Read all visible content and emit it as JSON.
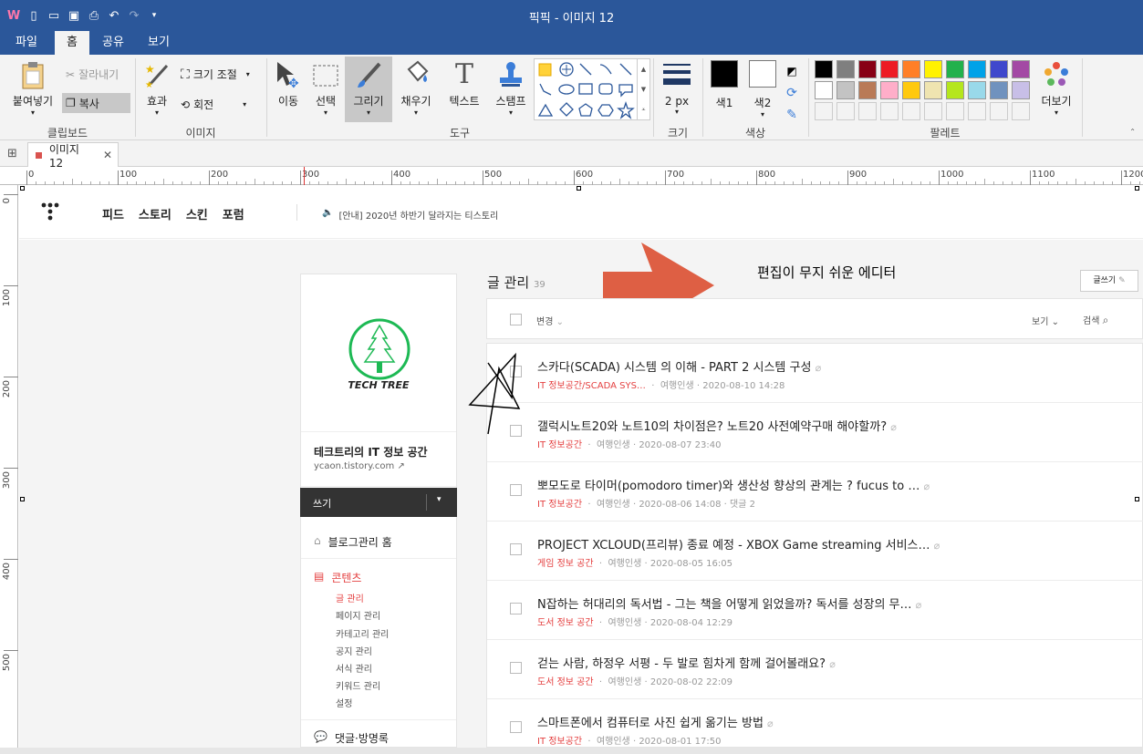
{
  "app": {
    "title": "픽픽 - 이미지 12"
  },
  "menu": {
    "items": [
      "파일",
      "홈",
      "공유",
      "보기"
    ],
    "active": "홈"
  },
  "ribbon": {
    "clipboard": {
      "paste": "붙여넣기",
      "cut": "잘라내기",
      "copy": "복사",
      "label": "클립보드"
    },
    "image": {
      "effect": "효과",
      "resize": "크기 조절",
      "rotate": "회전",
      "label": "이미지"
    },
    "tools": {
      "move": "이동",
      "select": "선택",
      "draw": "그리기",
      "fill": "채우기",
      "text": "텍스트",
      "stamp": "스탬프",
      "label": "도구"
    },
    "size": {
      "value": "2 px",
      "label": "크기"
    },
    "color": {
      "color1": "색1",
      "color2": "색2",
      "label": "색상",
      "color1_value": "#000000",
      "color2_value": "#ffffff"
    },
    "palette": {
      "label": "팔레트",
      "more": "더보기",
      "row1": [
        "#000000",
        "#7f7f7f",
        "#880015",
        "#ed1c24",
        "#ff7f27",
        "#fff200",
        "#22b14c",
        "#00a2e8",
        "#3f48cc",
        "#a349a4"
      ],
      "row2": [
        "#ffffff",
        "#c3c3c3",
        "#b97a57",
        "#ffaec9",
        "#ffc90e",
        "#efe4b0",
        "#b5e61d",
        "#99d9ea",
        "#7092be",
        "#c8bfe7"
      ],
      "row3": [
        "#f3f3f3",
        "#f3f3f3",
        "#f3f3f3",
        "#f3f3f3",
        "#f3f3f3",
        "#f3f3f3",
        "#f3f3f3",
        "#f3f3f3",
        "#f3f3f3",
        "#f3f3f3"
      ]
    }
  },
  "doc": {
    "tab": "이미지 12"
  },
  "ruler": {
    "h": [
      "0",
      "100",
      "200",
      "300",
      "400",
      "500",
      "600",
      "700",
      "800",
      "900",
      "1000",
      "1100",
      "1200"
    ],
    "v": [
      "0",
      "100",
      "200",
      "300",
      "400",
      "500"
    ]
  },
  "blog": {
    "nav": [
      "피드",
      "스토리",
      "스킨",
      "포럼"
    ],
    "notice": "[안내] 2020년 하반기 달라지는 티스토리",
    "page_title": "글 관리",
    "post_count": "39",
    "write_btn": "글쓰기",
    "change": "변경",
    "view": "보기",
    "search": "검색",
    "annotation": "편집이 무지 쉬운 에디터",
    "logo_text": "TECH TREE",
    "blog_name": "테크트리의 IT 정보 공간",
    "blog_url": "ycaon.tistory.com",
    "write": "쓰기",
    "menu_home": "블로그관리 홈",
    "menu_contents": "콘텐츠",
    "sub": [
      "글 관리",
      "페이지 관리",
      "카테고리 관리",
      "공지 관리",
      "서식 관리",
      "키워드 관리",
      "설정"
    ],
    "menu_comments": "댓글·방명록",
    "posts": [
      {
        "title": "스카다(SCADA) 시스템 의 이해 - PART 2 시스템 구성",
        "cat": "IT 정보공간/SCADA SYS…",
        "author": "여행인생",
        "date": "2020-08-10 14:28",
        "extra": ""
      },
      {
        "title": "갤럭시노트20와 노트10의 차이점은? 노트20 사전예약구매 해야할까?",
        "cat": "IT 정보공간",
        "author": "여행인생",
        "date": "2020-08-07 23:40",
        "extra": ""
      },
      {
        "title": "뽀모도로 타이머(pomodoro timer)와 생산성 향상의 관계는 ? fucus to …",
        "cat": "IT 정보공간",
        "author": "여행인생",
        "date": "2020-08-06 14:08",
        "extra": "댓글 2"
      },
      {
        "title": "PROJECT XCLOUD(프리뷰) 종료 예정 - XBOX Game streaming 서비스…",
        "cat": "게임 정보 공간",
        "author": "여행인생",
        "date": "2020-08-05 16:05",
        "extra": ""
      },
      {
        "title": "N잡하는 허대리의 독서법 - 그는 책을 어떻게 읽었을까? 독서를 성장의 무…",
        "cat": "도서 정보 공간",
        "author": "여행인생",
        "date": "2020-08-04 12:29",
        "extra": ""
      },
      {
        "title": "걷는 사람, 하정우 서평 - 두 발로 힘차게 함께 걸어볼래요?",
        "cat": "도서 정보 공간",
        "author": "여행인생",
        "date": "2020-08-02 22:09",
        "extra": ""
      },
      {
        "title": "스마트폰에서 컴퓨터로 사진 쉽게 옮기는 방법",
        "cat": "IT 정보공간",
        "author": "여행인생",
        "date": "2020-08-01 17:50",
        "extra": ""
      }
    ]
  }
}
